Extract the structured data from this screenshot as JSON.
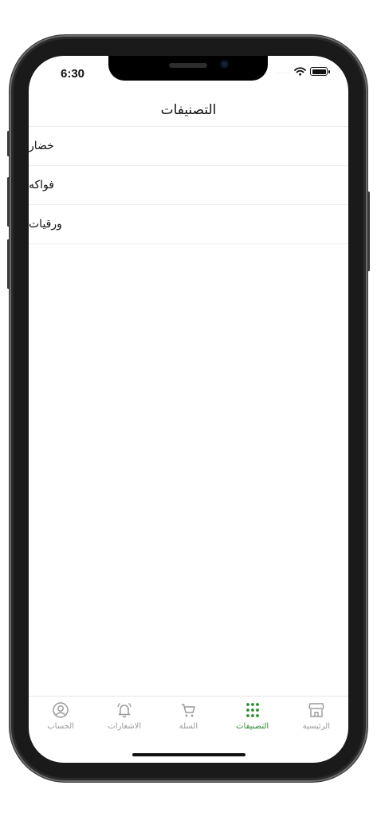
{
  "status_bar": {
    "time": "6:30",
    "signal": "....."
  },
  "header": {
    "title": "التصنيفات"
  },
  "categories": [
    {
      "label": "خضار"
    },
    {
      "label": "فواكه"
    },
    {
      "label": "ورقيات"
    }
  ],
  "tabbar": {
    "items": [
      {
        "label": "الحساب",
        "icon": "account-icon",
        "active": false
      },
      {
        "label": "الاشعارات",
        "icon": "bell-icon",
        "active": false
      },
      {
        "label": "السلة",
        "icon": "cart-icon",
        "active": false
      },
      {
        "label": "التصنيفات",
        "icon": "grid-icon",
        "active": true
      },
      {
        "label": "الرئيسية",
        "icon": "store-icon",
        "active": false
      }
    ]
  },
  "colors": {
    "accent": "#2e8b2e",
    "inactive": "#9a9a9a",
    "text": "#111111",
    "divider": "#efefef"
  }
}
